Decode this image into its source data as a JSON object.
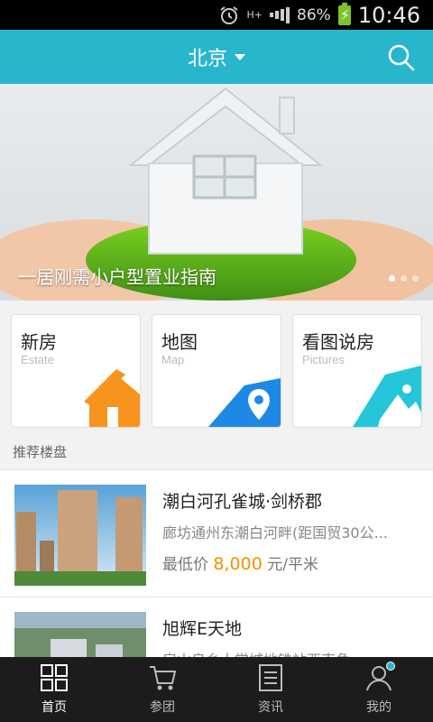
{
  "status_bar": {
    "battery": "86%",
    "network": "H+",
    "time": "10:46"
  },
  "header": {
    "city": "北京",
    "search_icon": "search-icon"
  },
  "banner": {
    "caption": "一居刚需小户型置业指南",
    "dots_total": 3,
    "active_dot": 1
  },
  "categories": [
    {
      "title": "新房",
      "subtitle": "Estate",
      "icon": "house-icon",
      "color": "#f7941d"
    },
    {
      "title": "地图",
      "subtitle": "Map",
      "icon": "map-pin-icon",
      "color": "#1e88e5"
    },
    {
      "title": "看图说房",
      "subtitle": "Pictures",
      "icon": "picture-icon",
      "color": "#26c6da"
    }
  ],
  "section": {
    "title": "推荐楼盘"
  },
  "listings": [
    {
      "title": "潮白河孔雀城·剑桥郡",
      "address": "廊坊通州东潮白河畔(距国贸30公...",
      "price_label": "最低价",
      "price": "8,000",
      "unit": "元/平米"
    },
    {
      "title": "旭辉E天地",
      "address": "房山良乡大学城地铁站西南角",
      "price_label": "",
      "price": "",
      "unit": ""
    }
  ],
  "nav": [
    {
      "label": "首页",
      "icon": "home-grid-icon",
      "active": true
    },
    {
      "label": "参团",
      "icon": "cart-icon",
      "active": false
    },
    {
      "label": "资讯",
      "icon": "news-icon",
      "active": false
    },
    {
      "label": "我的",
      "icon": "user-icon",
      "active": false
    }
  ]
}
